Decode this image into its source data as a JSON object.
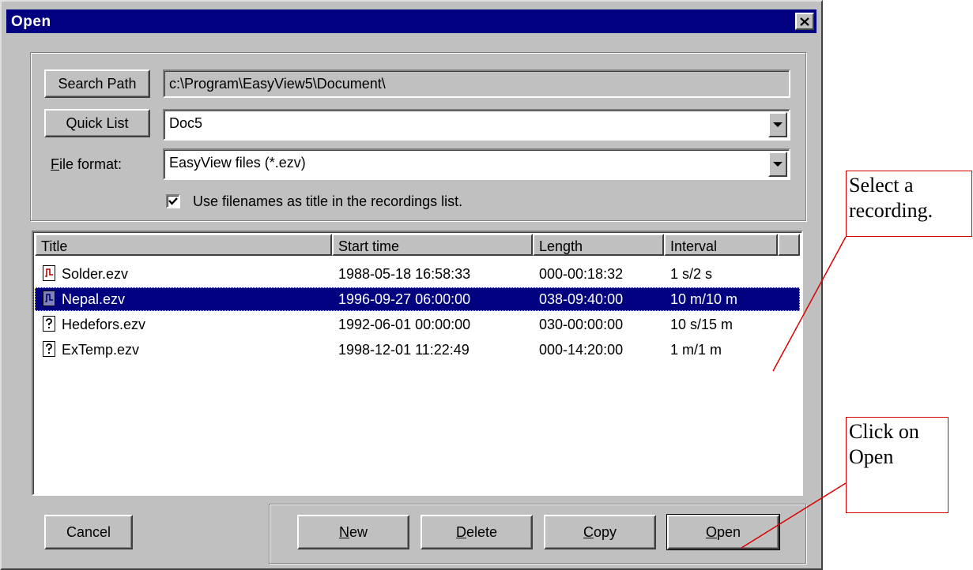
{
  "window": {
    "title": "Open"
  },
  "search_path": {
    "button_label": "Search Path",
    "value": "c:\\Program\\EasyView5\\Document\\"
  },
  "quick_list": {
    "button_label": "Quick List",
    "selected": "Doc5"
  },
  "file_format": {
    "label_pre": "",
    "label_accel": "F",
    "label_post": "ile format:",
    "selected": "EasyView files (*.ezv)"
  },
  "option": {
    "checked": true,
    "label": "Use filenames as title in the recordings list."
  },
  "list": {
    "columns": [
      "Title",
      "Start time",
      "Length",
      "Interval"
    ],
    "rows": [
      {
        "icon": "waveform-file-icon",
        "title": "Solder.ezv",
        "start": "1988-05-18  16:58:33",
        "length": "000-00:18:32",
        "interval": "1 s/2 s",
        "selected": false
      },
      {
        "icon": "waveform-file-icon",
        "title": "Nepal.ezv",
        "start": "1996-09-27  06:00:00",
        "length": "038-09:40:00",
        "interval": "10 m/10 m",
        "selected": true
      },
      {
        "icon": "unknown-file-icon",
        "title": "Hedefors.ezv",
        "start": "1992-06-01  00:00:00",
        "length": "030-00:00:00",
        "interval": "10 s/15 m",
        "selected": false
      },
      {
        "icon": "unknown-file-icon",
        "title": "ExTemp.ezv",
        "start": "1998-12-01  11:22:49",
        "length": "000-14:20:00",
        "interval": "1 m/1 m",
        "selected": false
      }
    ]
  },
  "buttons": {
    "cancel": "Cancel",
    "new": {
      "accel": "N",
      "rest": "ew"
    },
    "delete": {
      "accel": "D",
      "rest": "elete"
    },
    "copy": {
      "accel": "C",
      "rest": "opy"
    },
    "open": {
      "accel": "O",
      "rest": "pen"
    }
  },
  "annotations": {
    "select": "Select a recording.",
    "open": "Click on Open"
  },
  "colors": {
    "titlebar": "#000080",
    "face": "#c0c0c0",
    "selection": "#000080",
    "annotation_border": "#d80000"
  }
}
